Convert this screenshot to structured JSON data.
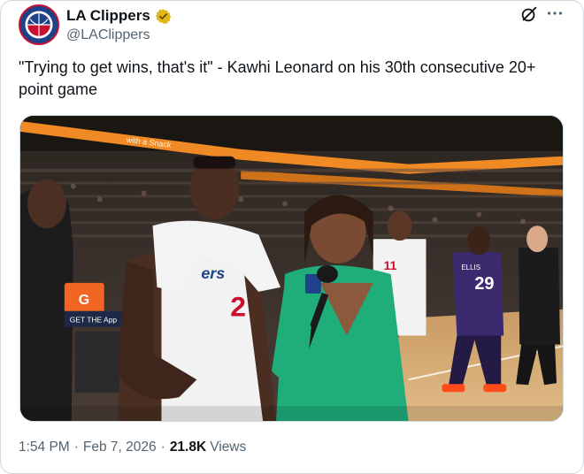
{
  "account": {
    "display_name": "LA Clippers",
    "handle": "@LAClippers",
    "avatar_icon": "la-clippers-logo",
    "verified_icon": "gold-verified-badge-icon"
  },
  "header_actions": {
    "grok_icon": "grok-icon",
    "more_icon": "more-options-icon"
  },
  "tweet": {
    "text": "\"Trying to get wins, that's it\" - Kawhi Leonard on his 30th consecutive 20+ point game"
  },
  "media": {
    "banner_text": "with a Snack",
    "jersey_text": "ers",
    "jersey_number_player": "2",
    "jersey_number_right": "29",
    "jersey_number_mid": "11",
    "jersey_name_right": "ELLIS",
    "cooler_letter": "G",
    "courtside_sign": "GET THE App",
    "colors": {
      "arena_orange": "#f08a24",
      "clippers_white": "#f2f2f2",
      "kings_purple": "#3b2b6e",
      "host_green": "#1fae7a",
      "court_wood": "#d9b07a"
    }
  },
  "meta": {
    "time": "1:54 PM",
    "date": "Feb 7, 2026",
    "views_count": "21.8K",
    "views_label": "Views",
    "separator": "·"
  }
}
